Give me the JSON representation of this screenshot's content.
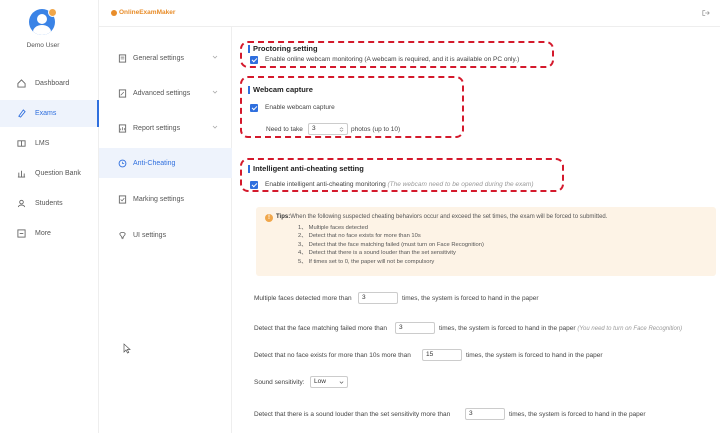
{
  "app": {
    "logo_text": "OnlineExamMaker"
  },
  "user": {
    "name": "Demo User"
  },
  "nav": {
    "items": [
      {
        "label": "Dashboard",
        "icon": "dashboard-icon"
      },
      {
        "label": "Exams",
        "icon": "exam-icon",
        "active": true
      },
      {
        "label": "LMS",
        "icon": "lms-icon"
      },
      {
        "label": "Question Bank",
        "icon": "question-bank-icon"
      },
      {
        "label": "Students",
        "icon": "students-icon"
      },
      {
        "label": "More",
        "icon": "more-icon"
      }
    ]
  },
  "settings_menu": {
    "items": [
      {
        "label": "General settings",
        "icon": "general-settings-icon",
        "chevron": true
      },
      {
        "label": "Advanced settings",
        "icon": "advanced-settings-icon",
        "chevron": true
      },
      {
        "label": "Report settings",
        "icon": "report-settings-icon",
        "chevron": true
      },
      {
        "label": "Anti-Cheating",
        "icon": "anti-cheating-icon",
        "active": true
      },
      {
        "label": "Marking settings",
        "icon": "marking-settings-icon"
      },
      {
        "label": "UI settings",
        "icon": "ui-settings-icon"
      }
    ]
  },
  "proctoring": {
    "title": "Proctoring setting",
    "checkbox_label": "Enable online webcam monitoring (A webcam is required, and it is available on PC only.)"
  },
  "webcam": {
    "title": "Webcam capture",
    "checkbox_label": "Enable webcam capture",
    "need_prefix": "Need to take",
    "photo_count": "3",
    "need_suffix": "photos (up to 10)"
  },
  "intelligent": {
    "title": "Intelligent anti-cheating setting",
    "checkbox_label": "Enable intelligent anti-cheating monitoring",
    "checkbox_hint": "(The webcam need to be opened during the exam)"
  },
  "tips": {
    "prefix": "Tips:",
    "text": "When the following suspected cheating behaviors occur and exceed the set times, the exam will be forced to submitted.",
    "items": [
      "1、 Multiple faces detected",
      "2、 Detect that no face exists for more than 10s",
      "3、 Detect that the face matching failed (must turn on Face Recognition)",
      "4、 Detect that there is a sound louder than the set sensitivity",
      "5、 If times set to 0, the paper will not be compulsory"
    ]
  },
  "rules": {
    "multiple_faces": {
      "prefix": "Multiple faces detected more than",
      "value": "3",
      "suffix": "times, the system is forced to hand in the paper"
    },
    "face_match": {
      "prefix": "Detect that the face matching failed more than",
      "value": "3",
      "suffix": "times, the system is forced to hand in the paper",
      "hint": "(You need to turn on Face Recognition)"
    },
    "no_face": {
      "prefix": "Detect that no face exists for more than 10s more than",
      "value": "15",
      "suffix": "times, the system is forced to hand in the paper"
    },
    "sensitivity": {
      "label": "Sound sensitivity:",
      "value": "Low"
    },
    "sound": {
      "prefix": "Detect that there is a sound louder than the set sensitivity more than",
      "value": "3",
      "suffix": "times, the system is forced to hand in the paper"
    }
  },
  "colors": {
    "accent": "#2f6fde",
    "highlight_border": "#d4192c",
    "tips_bg": "#fdf3e6",
    "logo": "#e88d2a"
  }
}
